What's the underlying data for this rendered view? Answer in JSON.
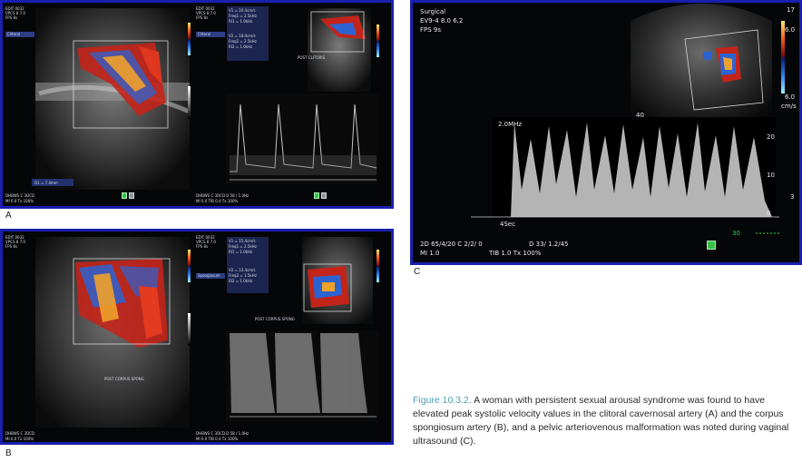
{
  "panels": {
    "A": {
      "letter": "A",
      "left_header": [
        "EDIT 0032",
        "VPCS 8 7.0",
        "FPS 8s"
      ],
      "left_side_label": "Clitoral",
      "left_measure": "D1 = 7.4mm",
      "left_footer": [
        "DHBWS C 3DCD",
        "MI 0.0  Tx 100%"
      ],
      "right_header": [
        "EDIT 0032",
        "VPCS 8 7.0",
        "FPS 8s"
      ],
      "right_side_label": "Clitoral",
      "right_values": [
        "V1 = 16.4cm/s",
        "Freq1 = 2.5kHz",
        "RI1 = 1.0kHz"
      ],
      "right_values2": [
        "V2 = 18.0cm/s",
        "Freq2 = 2.5kHz",
        "RI2 = 1.0kHz"
      ],
      "right_image_label": "POST CLITORIS",
      "right_footer": [
        "DHBWS C 3DCD  D 58 / 1.0Hz",
        "MI 0.0  TIB 0.4  Tx 100%"
      ]
    },
    "B": {
      "letter": "B",
      "left_header": [
        "EDIT 0032",
        "VPCS 8 7.0",
        "FPS 8s"
      ],
      "left_image_label": "POST CORPUS SPONG",
      "left_footer": [
        "DHBWS C 3DCD",
        "MI 0.0  Tx 100%"
      ],
      "right_header": [
        "EDIT 0032",
        "VPCS 8 7.0",
        "FPS 8s"
      ],
      "right_side_label": "Spongiosum",
      "right_values": [
        "V1 = 15.4cm/s",
        "Freq1 = 2.5kHz",
        "RI1 = 1.0kHz"
      ],
      "right_values2": [
        "V2 = 12.4cm/s",
        "Freq2 = 1.5kHz",
        "RI2 = 1.0kHz"
      ],
      "right_image_label": "POST CORPUS SPONG",
      "right_footer": [
        "DHBWS C 3DCD  D 58 / 1.0Hz",
        "MI 0.0  TIB 0.4  Tx 100%"
      ]
    },
    "C": {
      "letter": "C",
      "header": [
        "Surgical",
        "EV9-4   8.0   6.2",
        "FPS     9s"
      ],
      "depth_top": "17",
      "scale_top": "6.0",
      "scale_bottom": "6.0",
      "scale_unit": "cm/s",
      "depth_bottom": "40",
      "doppler_freq": "2.0MHz",
      "doppler_ticks": [
        "20",
        "10",
        "0"
      ],
      "doppler_right": "3",
      "time_label": "4Sec",
      "footer_left": [
        "2D 65/4/20  C 2/2/ 0",
        "MI 1.0"
      ],
      "footer_mid": [
        "D    33/ 1.2/45",
        "TIB 1.0   Tx 100%"
      ],
      "footer_tag": "30"
    }
  },
  "caption": {
    "figure": "Figure 10.3.2.",
    "text": " A woman with persistent sexual arousal syndrome was found to have elevated peak systolic velocity values in the clitoral cavernosal artery (A) and the corpus spongiosum artery (B), and a pelvic arteriovenous malformation was noted during vaginal ultrasound (C)."
  },
  "colors": {
    "frame": "#1a1fae",
    "caption_figure": "#4e9fb4",
    "doppler_red": "#e02a1c",
    "doppler_blue": "#2d6bd8",
    "doppler_orange": "#f5a51e"
  }
}
